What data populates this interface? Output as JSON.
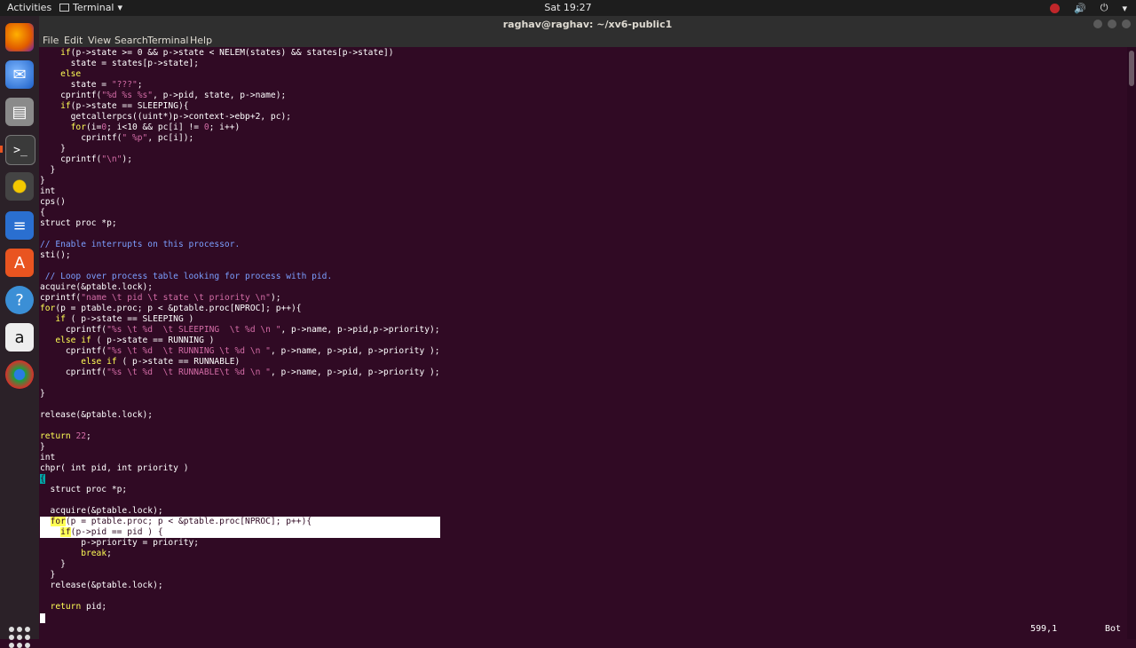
{
  "topbar": {
    "activities": "Activities",
    "app_name": "Terminal",
    "clock": "Sat 19:27"
  },
  "window": {
    "title": "raghav@raghav: ~/xv6-public1"
  },
  "menu": [
    "File",
    "Edit",
    "View",
    "Search",
    "Terminal",
    "Help"
  ],
  "dock_icons": [
    "firefox-icon",
    "thunderbird-icon",
    "files-icon",
    "terminal-icon",
    "rhythmbox-icon",
    "writer-icon",
    "software-center-icon",
    "help-icon",
    "amazon-icon",
    "chromium-icon"
  ],
  "colors": {
    "terminal_bg": "#300a24",
    "accent": "#e95420"
  },
  "code_lines": [
    "    if(p->state >= 0 && p->state < NELEM(states) && states[p->state])",
    "      state = states[p->state];",
    "    else",
    "      state = \"???\";",
    "    cprintf(\"%d %s %s\", p->pid, state, p->name);",
    "    if(p->state == SLEEPING){",
    "      getcallerpcs((uint*)p->context->ebp+2, pc);",
    "      for(i=0; i<10 && pc[i] != 0; i++)",
    "        cprintf(\" %p\", pc[i]);",
    "    }",
    "    cprintf(\"\\n\");",
    "  }",
    "}",
    "int",
    "cps()",
    "{",
    "struct proc *p;",
    "",
    "// Enable interrupts on this processor.",
    "sti();",
    "",
    " // Loop over process table looking for process with pid.",
    "acquire(&ptable.lock);",
    "cprintf(\"name \\t pid \\t state \\t priority \\n\");",
    "for(p = ptable.proc; p < &ptable.proc[NPROC]; p++){",
    "   if ( p->state == SLEEPING )",
    "     cprintf(\"%s \\t %d  \\t SLEEPING  \\t %d \\n \", p->name, p->pid,p->priority);",
    "   else if ( p->state == RUNNING )",
    "     cprintf(\"%s \\t %d  \\t RUNNING \\t %d \\n \", p->name, p->pid, p->priority );",
    "        else if ( p->state == RUNNABLE)",
    "     cprintf(\"%s \\t %d  \\t RUNNABLE\\t %d \\n \", p->name, p->pid, p->priority );",
    "",
    "}",
    "",
    "release(&ptable.lock);",
    "",
    "return 22;",
    "}",
    "int",
    "chpr( int pid, int priority )",
    "{",
    "  struct proc *p;",
    "",
    "  acquire(&ptable.lock);",
    "  for(p = ptable.proc; p < &ptable.proc[NPROC]; p++){",
    "    if(p->pid == pid ) {",
    "        p->priority = priority;",
    "        break;",
    "    }",
    "  }",
    "  release(&ptable.lock);",
    "",
    "  return pid;"
  ],
  "status": {
    "position": "599,1",
    "scroll": "Bot"
  }
}
